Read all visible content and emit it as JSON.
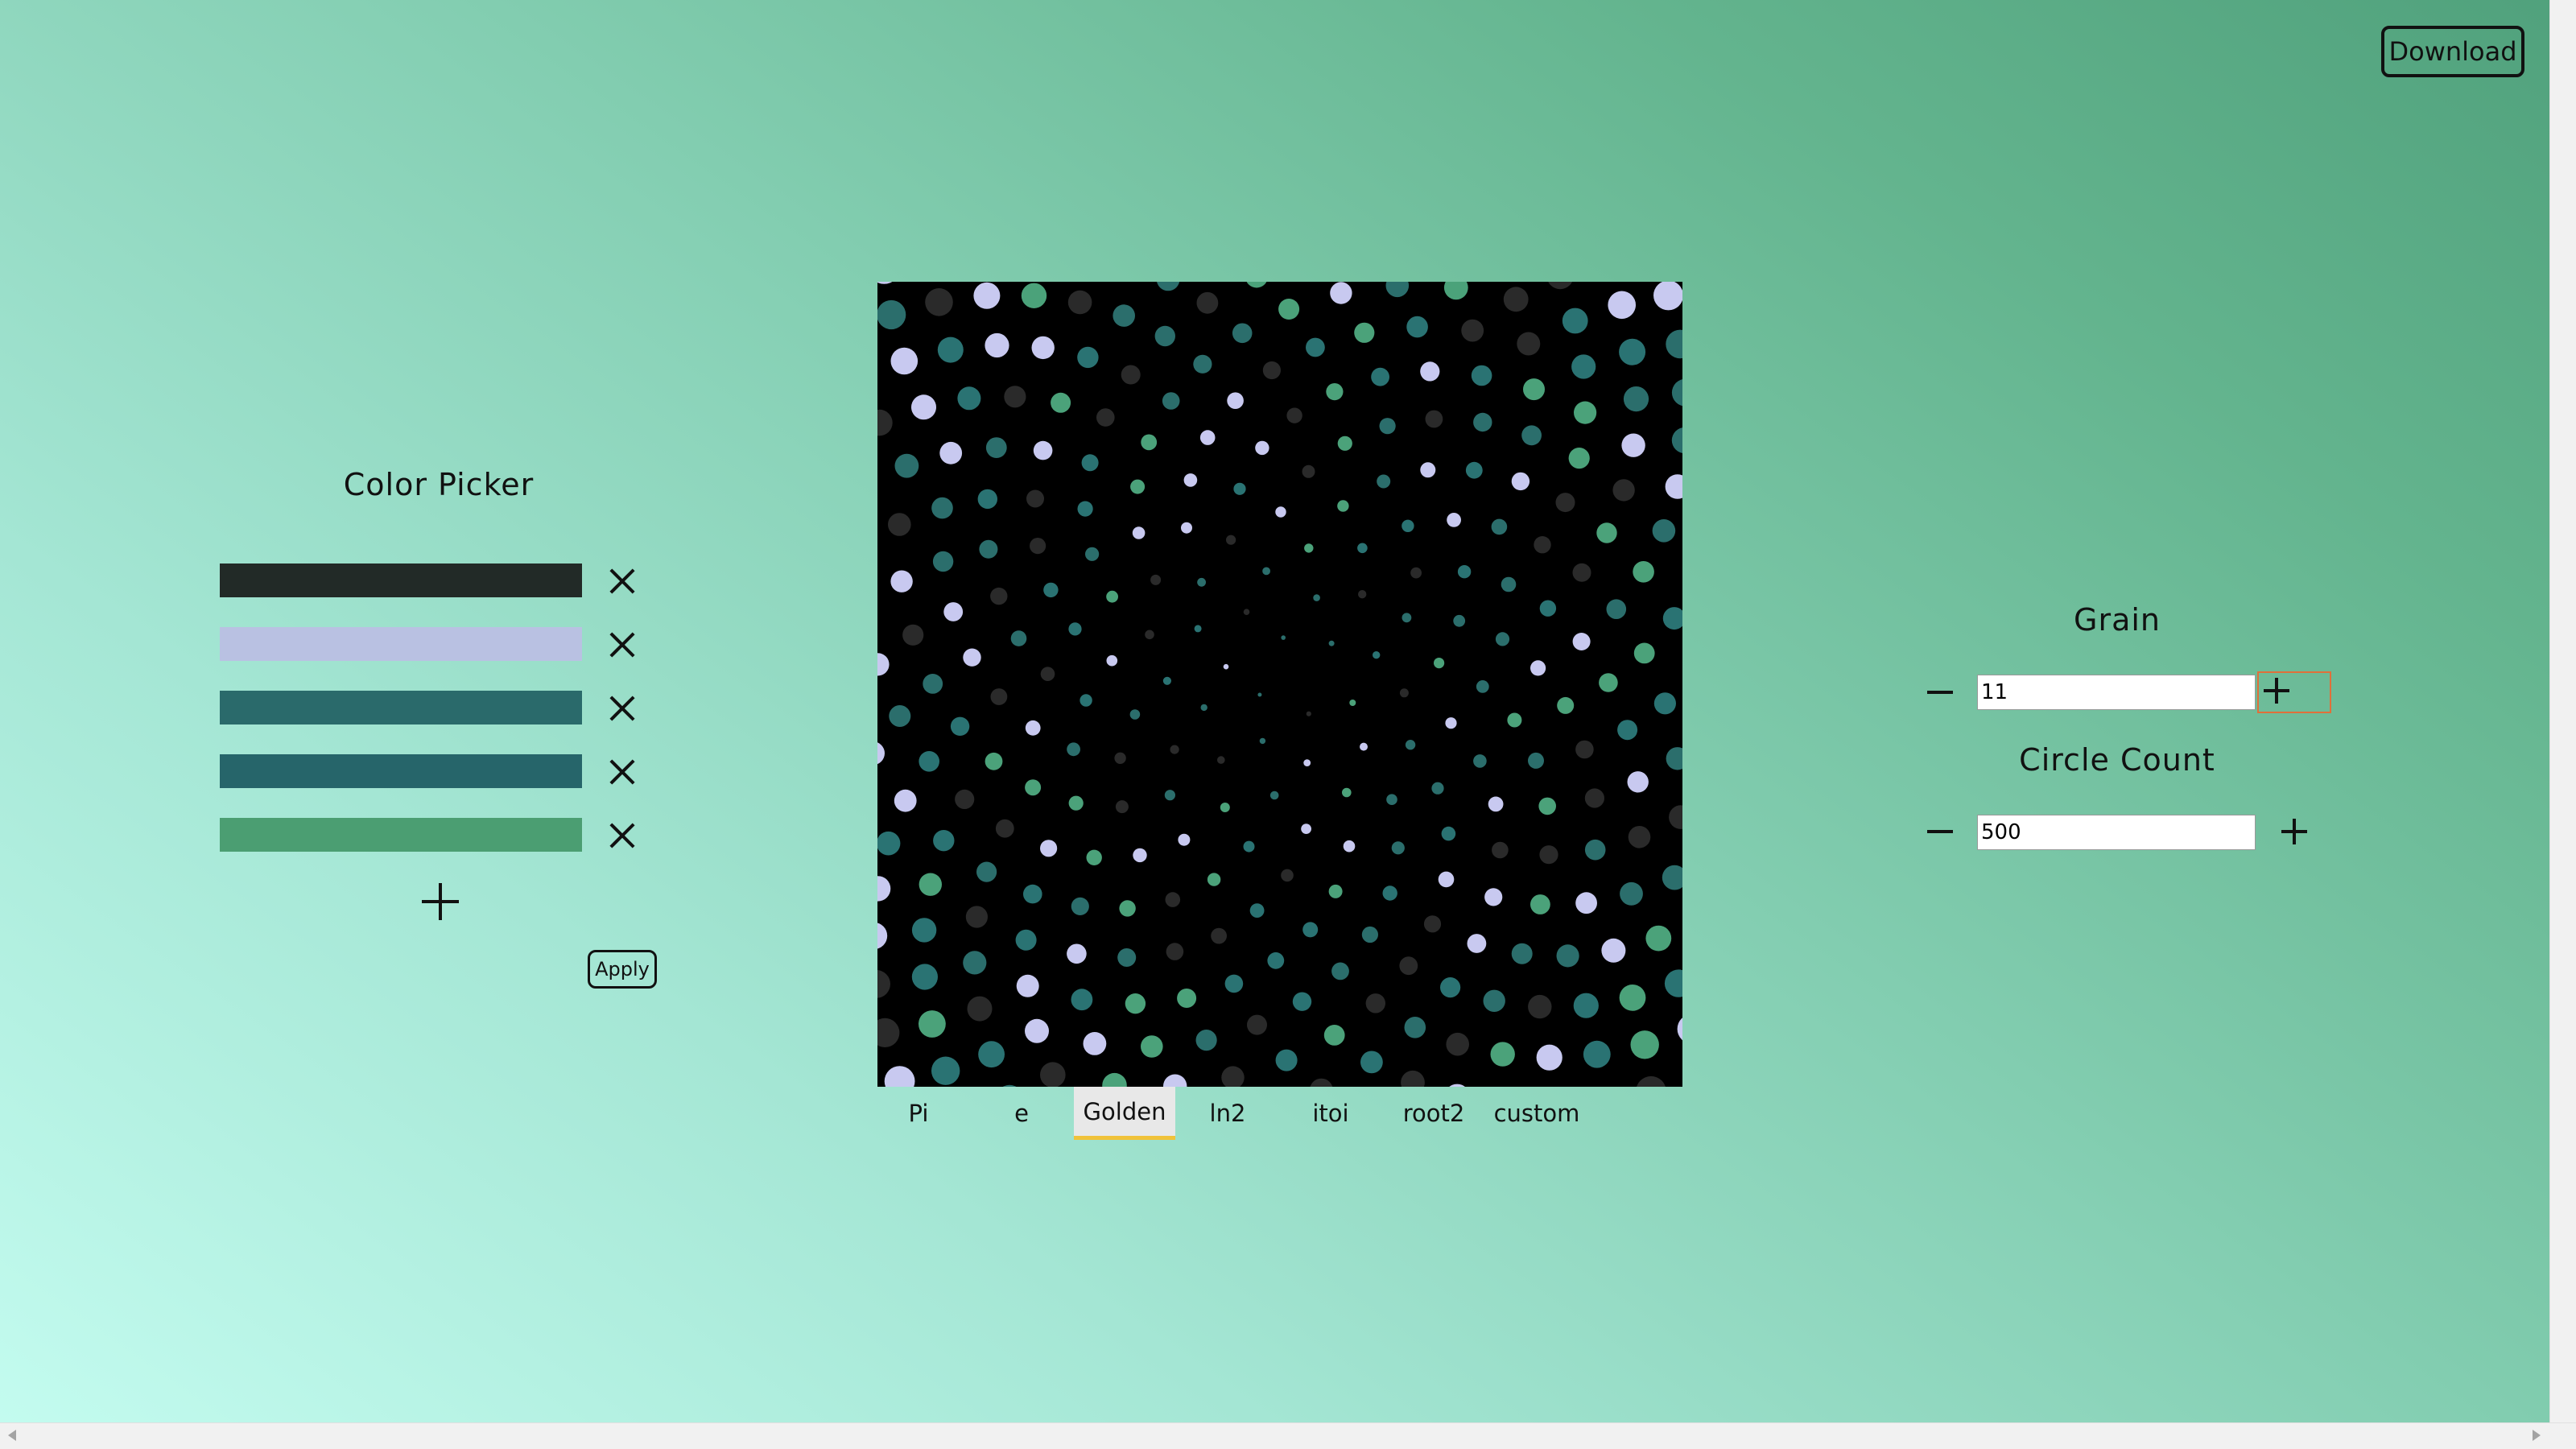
{
  "header": {
    "download_label": "Download"
  },
  "color_picker": {
    "title": "Color Picker",
    "colors": [
      {
        "hex": "#222a27"
      },
      {
        "hex": "#b9c1e2"
      },
      {
        "hex": "#2a6a6b"
      },
      {
        "hex": "#26656a"
      },
      {
        "hex": "#4b9e72"
      }
    ],
    "add_icon": "plus-icon",
    "remove_icon": "x-icon",
    "apply_label": "Apply"
  },
  "canvas": {
    "background": "#000000",
    "palette": [
      "#2a2a2a",
      "#c8c9f0",
      "#2b6e6c",
      "#2a7373",
      "#4ba27a"
    ]
  },
  "tabs": [
    {
      "label": "Pi",
      "active": false
    },
    {
      "label": "e",
      "active": false
    },
    {
      "label": "Golden",
      "active": true
    },
    {
      "label": "ln2",
      "active": false
    },
    {
      "label": "itoi",
      "active": false
    },
    {
      "label": "root2",
      "active": false
    },
    {
      "label": "custom",
      "active": false
    }
  ],
  "controls": {
    "grain": {
      "label": "Grain",
      "value": "11",
      "minus_icon": "minus-icon",
      "plus_icon": "plus-icon"
    },
    "circle_count": {
      "label": "Circle Count",
      "value": "500",
      "minus_icon": "minus-icon",
      "plus_icon": "plus-icon"
    }
  }
}
